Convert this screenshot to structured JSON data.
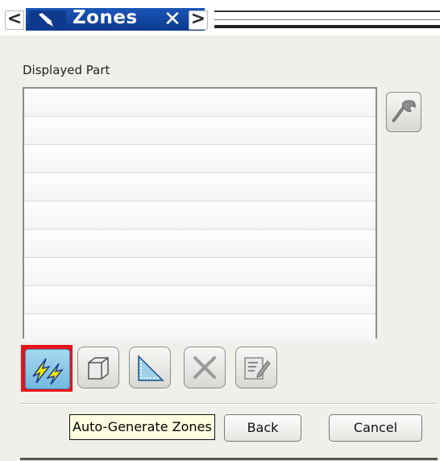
{
  "titlebar": {
    "title": "Zones",
    "back_arrow": "<",
    "forward_arrow": ">",
    "close_glyph": "✕"
  },
  "section": {
    "label": "Displayed Part"
  },
  "list": {
    "rows": [
      "",
      "",
      "",
      "",
      "",
      "",
      "",
      "",
      ""
    ]
  },
  "toolbar": {
    "icons": [
      "auto-generate-zones-icon",
      "cube-icon",
      "triangle-zone-icon",
      "delete-x-icon",
      "edit-note-icon"
    ]
  },
  "tooltip": {
    "text": "Auto-Generate Zones"
  },
  "buttons": {
    "back": "Back",
    "cancel": "Cancel"
  },
  "colors": {
    "title_bar": "#1a56b8",
    "selection_outline": "#e8141a",
    "selected_fill": "#8ccbe8",
    "tooltip_bg": "#ffffe1"
  }
}
